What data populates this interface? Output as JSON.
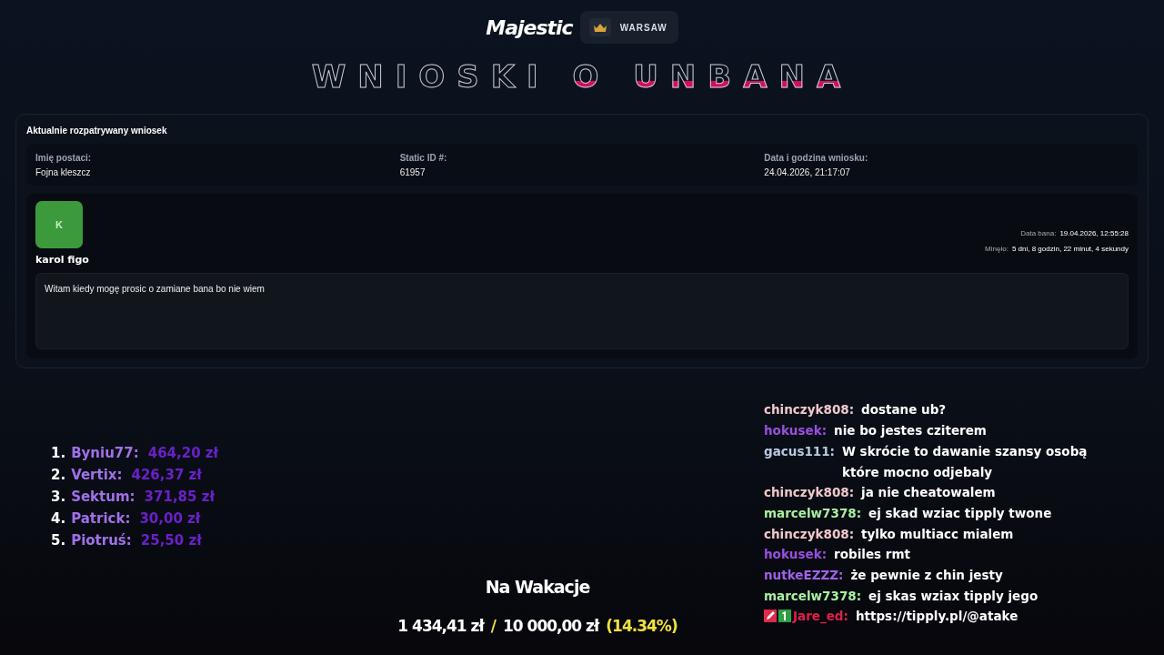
{
  "header": {
    "logo": "Majestic",
    "server": "WARSAW"
  },
  "title": "WNIOSKI O UNBANA",
  "request": {
    "heading": "Aktualnie rozpatrywany wniosek",
    "fields": [
      {
        "label": "Imię postaci:",
        "value": "Fojna kleszcz"
      },
      {
        "label": "Static ID #:",
        "value": "61957"
      },
      {
        "label": "Data i godzina wniosku:",
        "value": "24.04.2026, 21:17:07"
      }
    ],
    "avatar_letter": "K",
    "author": "karol figo",
    "ban_date_label": "Data bana:",
    "ban_date": "19.04.2026, 12:55:28",
    "elapsed_label": "Minęło:",
    "elapsed": "5 dni, 8 godzin, 22 minut, 4 sekundy",
    "message": "Witam kiedy mogę prosic o zamiane bana bo nie wiem"
  },
  "leaderboard": [
    {
      "rank": "1.",
      "name": "Byniu77:",
      "amount": "464,20 zł"
    },
    {
      "rank": "2.",
      "name": "Vertix:",
      "amount": "426,37 zł"
    },
    {
      "rank": "3.",
      "name": "Sektum:",
      "amount": "371,85 zł"
    },
    {
      "rank": "4.",
      "name": "Patrick:",
      "amount": "30,00 zł"
    },
    {
      "rank": "5.",
      "name": "Piotruś:",
      "amount": "25,50 zł"
    }
  ],
  "goal": {
    "title": "Na Wakacje",
    "current": "1 434,41 zł",
    "separator": "/",
    "target": "10 000,00 zł",
    "percent": "(14.34%)"
  },
  "chat": [
    {
      "user": "chinczyk808:",
      "color": "#f0c8cc",
      "text": "dostane ub?",
      "badges": false
    },
    {
      "user": "hokusek:",
      "color": "#9b4ee0",
      "text": "nie bo jestes cziterem",
      "badges": false
    },
    {
      "user": "gacus111:",
      "color": "#b8c8e0",
      "text": "W skrócie to dawanie szansy osobą które mocno odjebaly",
      "badges": false
    },
    {
      "user": "chinczyk808:",
      "color": "#f0c8cc",
      "text": "ja nie cheatowalem",
      "badges": false
    },
    {
      "user": "marcelw7378:",
      "color": "#a8f0a0",
      "text": "ej skad wziac tipply twone",
      "badges": false
    },
    {
      "user": "chinczyk808:",
      "color": "#f0c8cc",
      "text": "tylko multiacc mialem",
      "badges": false
    },
    {
      "user": "hokusek:",
      "color": "#9b4ee0",
      "text": "robiles rmt",
      "badges": false
    },
    {
      "user": "nutkeEZZZ:",
      "color": "#a060e8",
      "text": "że pewnie z chin jesty",
      "badges": false
    },
    {
      "user": "marcelw7378:",
      "color": "#a8f0a0",
      "text": "ej skas wziax tipply jego",
      "badges": false
    },
    {
      "user": "Jare_ed:",
      "color": "#e0204a",
      "text": "https://tipply.pl/@atake",
      "badges": true
    }
  ]
}
